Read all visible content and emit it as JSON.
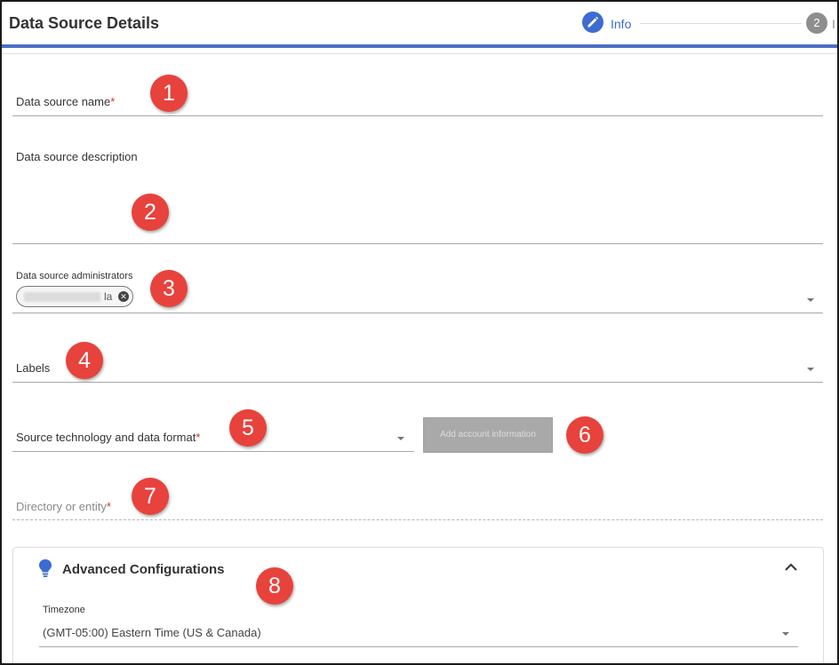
{
  "header": {
    "title": "Data Source Details",
    "steps": [
      {
        "number": "1",
        "label": "Info",
        "icon": "pencil-icon",
        "state": "active"
      },
      {
        "number": "2",
        "label": "I",
        "state": "pending"
      }
    ]
  },
  "form": {
    "name": {
      "label": "Data source name",
      "required": "*",
      "value": ""
    },
    "description": {
      "label": "Data source description",
      "value": ""
    },
    "administrators": {
      "label": "Data source administrators",
      "chips": [
        {
          "text": "la",
          "redacted": true
        }
      ]
    },
    "labels": {
      "label": "Labels",
      "value": ""
    },
    "source_technology": {
      "label": "Source technology and data format",
      "required": "*",
      "value": ""
    },
    "add_account_button": "Add account information",
    "directory": {
      "label": "Directory or entity",
      "required": "*",
      "disabled": true
    }
  },
  "advanced": {
    "title": "Advanced Configurations",
    "icon": "lightbulb-icon",
    "expanded": true,
    "timezone": {
      "label": "Timezone",
      "value": "(GMT-05:00) Eastern Time (US & Canada)"
    }
  },
  "annotations": [
    "1",
    "2",
    "3",
    "4",
    "5",
    "6",
    "7",
    "8"
  ],
  "colors": {
    "accent": "#3d6bd0",
    "required": "#d32f2f",
    "badge": "#e8423c"
  }
}
